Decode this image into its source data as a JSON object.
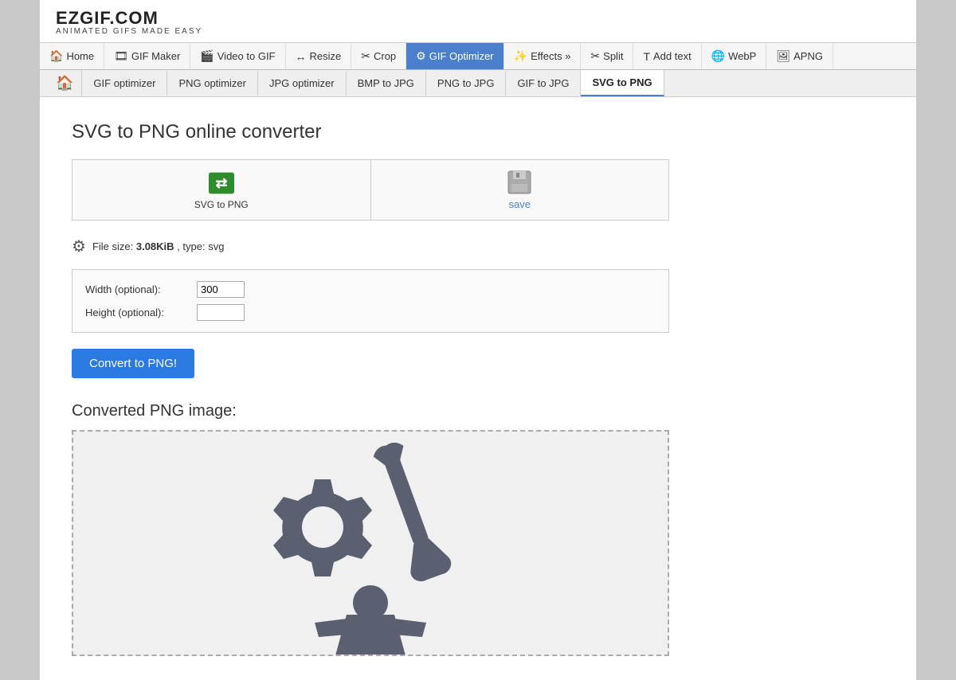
{
  "logo": {
    "title": "EZGIF.COM",
    "subtitle": "ANIMATED GIFS MADE EASY"
  },
  "nav": {
    "items": [
      {
        "id": "home",
        "label": "Home",
        "icon": "🏠",
        "active": false
      },
      {
        "id": "gif-maker",
        "label": "GIF Maker",
        "icon": "🎞",
        "active": false
      },
      {
        "id": "video-to-gif",
        "label": "Video to GIF",
        "icon": "🎬",
        "active": false
      },
      {
        "id": "resize",
        "label": "Resize",
        "icon": "↔",
        "active": false
      },
      {
        "id": "crop",
        "label": "Crop",
        "icon": "✂",
        "active": false
      },
      {
        "id": "gif-optimizer",
        "label": "GIF Optimizer",
        "icon": "⚙",
        "active": true
      },
      {
        "id": "effects",
        "label": "Effects »",
        "icon": "✨",
        "active": false
      },
      {
        "id": "split",
        "label": "Split",
        "icon": "✂",
        "active": false
      },
      {
        "id": "add-text",
        "label": "Add text",
        "icon": "T",
        "active": false
      },
      {
        "id": "webp",
        "label": "WebP",
        "icon": "🌐",
        "active": false
      },
      {
        "id": "apng",
        "label": "APNG",
        "icon": "🖼",
        "active": false
      }
    ]
  },
  "subnav": {
    "items": [
      {
        "id": "gif-optimizer",
        "label": "GIF optimizer",
        "active": false
      },
      {
        "id": "png-optimizer",
        "label": "PNG optimizer",
        "active": false
      },
      {
        "id": "jpg-optimizer",
        "label": "JPG optimizer",
        "active": false
      },
      {
        "id": "bmp-to-jpg",
        "label": "BMP to JPG",
        "active": false
      },
      {
        "id": "png-to-jpg",
        "label": "PNG to JPG",
        "active": false
      },
      {
        "id": "gif-to-jpg",
        "label": "GIF to JPG",
        "active": false
      },
      {
        "id": "svg-to-png",
        "label": "SVG to PNG",
        "active": true
      }
    ]
  },
  "page": {
    "title": "SVG to PNG online converter",
    "action_buttons": [
      {
        "id": "svg-to-png-btn",
        "label": "SVG to PNG",
        "icon_type": "svg-to-png"
      },
      {
        "id": "save-btn",
        "label": "save",
        "icon_type": "save"
      }
    ],
    "file_info": {
      "size_label": "File size:",
      "size_value": "3.08KiB",
      "type_label": ", type: svg"
    },
    "options": {
      "width_label": "Width (optional):",
      "width_value": "300",
      "height_label": "Height (optional):",
      "height_value": ""
    },
    "convert_button": "Convert to PNG!",
    "output_label": "Converted PNG image:"
  }
}
